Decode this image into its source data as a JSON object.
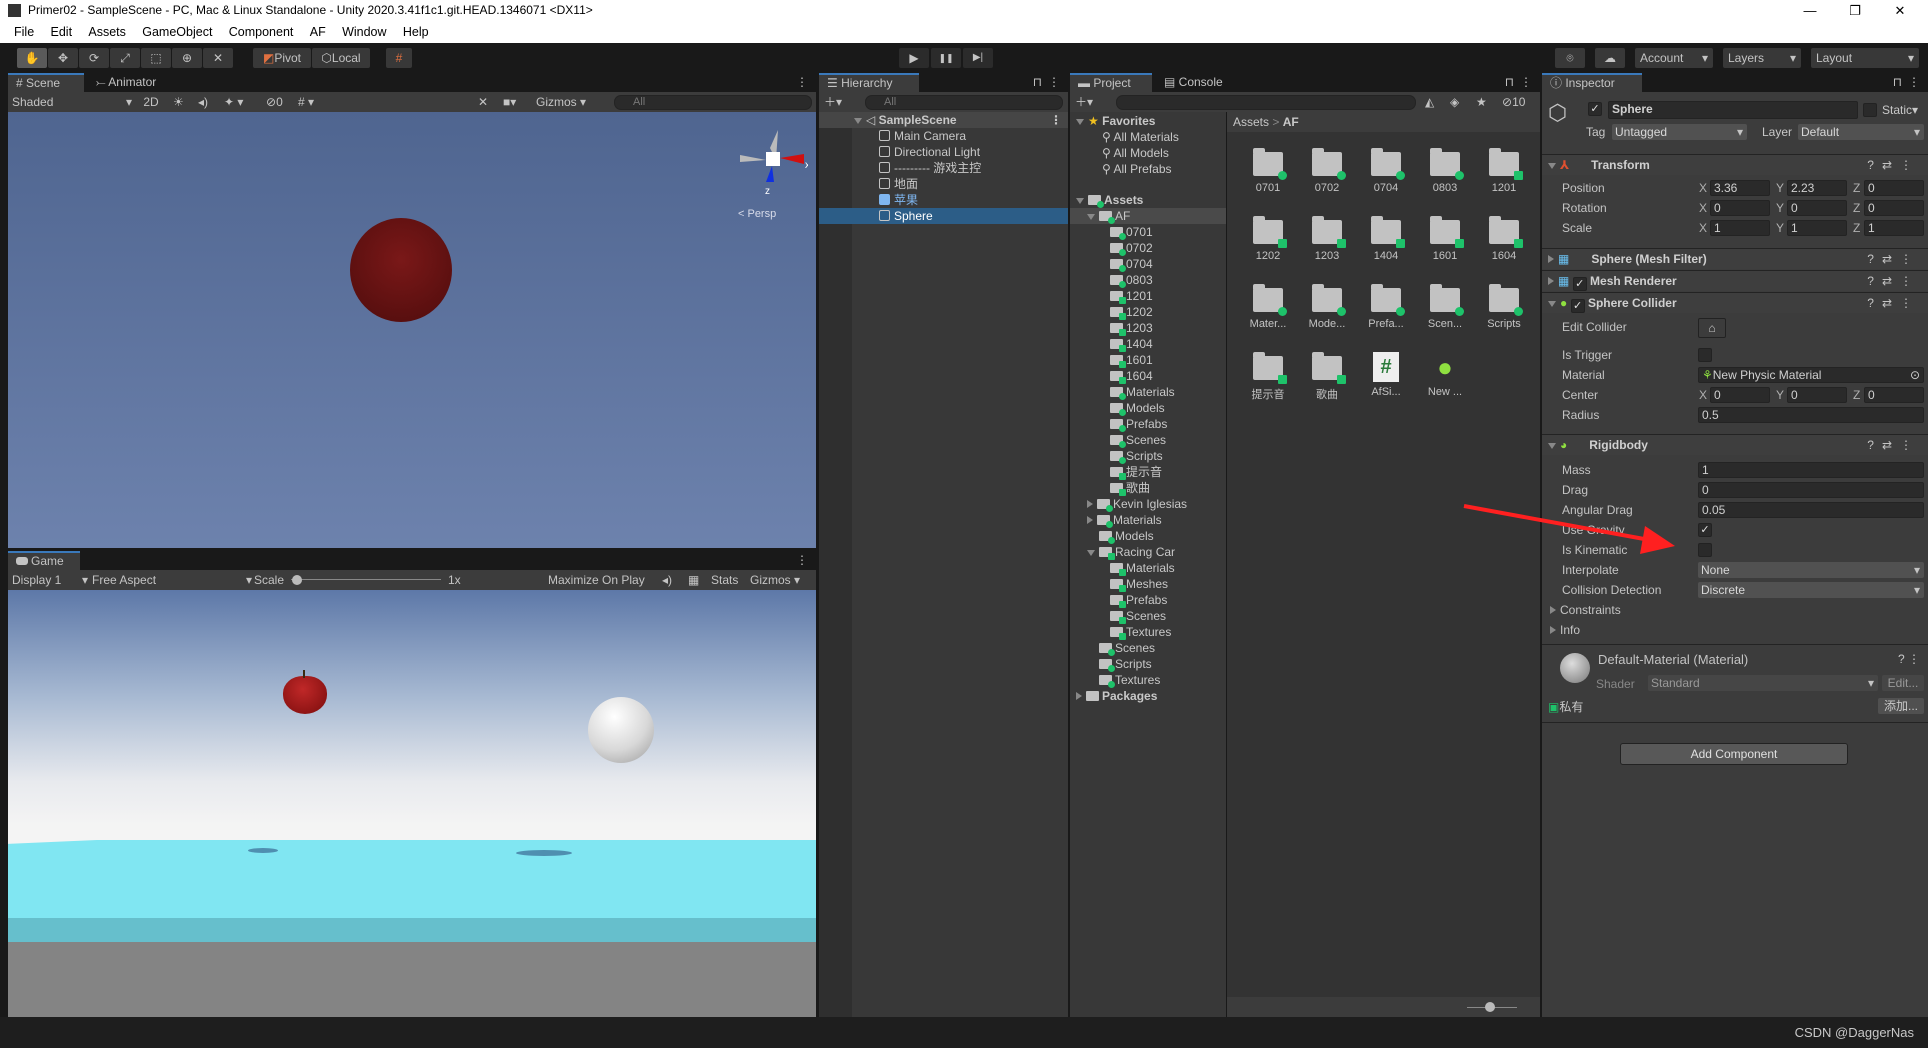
{
  "window": {
    "title": "Primer02 - SampleScene - PC, Mac & Linux Standalone - Unity 2020.3.41f1c1.git.HEAD.1346071 <DX11>",
    "min": "—",
    "max": "❐",
    "close": "✕"
  },
  "menu": [
    "File",
    "Edit",
    "Assets",
    "GameObject",
    "Component",
    "AF",
    "Window",
    "Help"
  ],
  "toolbar": {
    "pivot": "Pivot",
    "local": "Local",
    "account": "Account",
    "layers": "Layers",
    "layout": "Layout",
    "play": "▶",
    "pause": "❚❚",
    "step": "▶|"
  },
  "scene": {
    "tabs": [
      "Scene",
      "Animator"
    ],
    "shading": "Shaded",
    "mode2d": "2D",
    "hidden_count": "0",
    "gizmos": "Gizmos",
    "search_placeholder": "All",
    "gizmo_x": "x",
    "gizmo_z": "z",
    "persp": "< Persp"
  },
  "game": {
    "tab": "Game",
    "display": "Display 1",
    "aspect": "Free Aspect",
    "scale_label": "Scale",
    "scale_value": "1x",
    "maximize": "Maximize On Play",
    "stats": "Stats",
    "gizmos": "Gizmos"
  },
  "hierarchy": {
    "tab": "Hierarchy",
    "search_placeholder": "All",
    "scene": "SampleScene",
    "items": [
      {
        "label": "Main Camera"
      },
      {
        "label": "Directional Light"
      },
      {
        "label": "--------- 游戏主控"
      },
      {
        "label": "地面"
      },
      {
        "label": "苹果",
        "prefab": true
      },
      {
        "label": "Sphere",
        "selected": true
      }
    ]
  },
  "project": {
    "tabs": [
      "Project",
      "Console"
    ],
    "hidden_count": "10",
    "favorites": "Favorites",
    "favorite_items": [
      "All Materials",
      "All Models",
      "All Prefabs"
    ],
    "tree": [
      {
        "label": "Assets",
        "depth": 0,
        "arrow": "down",
        "bold": true
      },
      {
        "label": "AF",
        "depth": 1,
        "arrow": "down",
        "selected": true
      },
      {
        "label": "0701",
        "depth": 2
      },
      {
        "label": "0702",
        "depth": 2
      },
      {
        "label": "0704",
        "depth": 2
      },
      {
        "label": "0803",
        "depth": 2
      },
      {
        "label": "1201",
        "depth": 2,
        "sq": true
      },
      {
        "label": "1202",
        "depth": 2,
        "sq": true
      },
      {
        "label": "1203",
        "depth": 2,
        "sq": true
      },
      {
        "label": "1404",
        "depth": 2,
        "sq": true
      },
      {
        "label": "1601",
        "depth": 2,
        "sq": true
      },
      {
        "label": "1604",
        "depth": 2,
        "sq": true
      },
      {
        "label": "Materials",
        "depth": 2
      },
      {
        "label": "Models",
        "depth": 2
      },
      {
        "label": "Prefabs",
        "depth": 2
      },
      {
        "label": "Scenes",
        "depth": 2
      },
      {
        "label": "Scripts",
        "depth": 2
      },
      {
        "label": "提示音",
        "depth": 2,
        "sq": true
      },
      {
        "label": "歌曲",
        "depth": 2,
        "sq": true
      },
      {
        "label": "Kevin Iglesias",
        "depth": 1,
        "arrow": "right"
      },
      {
        "label": "Materials",
        "depth": 1,
        "arrow": "right"
      },
      {
        "label": "Models",
        "depth": 1
      },
      {
        "label": "Racing Car",
        "depth": 1,
        "arrow": "down",
        "sq": true
      },
      {
        "label": "Materials",
        "depth": 2,
        "sq": true
      },
      {
        "label": "Meshes",
        "depth": 2,
        "sq": true
      },
      {
        "label": "Prefabs",
        "depth": 2,
        "sq": true
      },
      {
        "label": "Scenes",
        "depth": 2,
        "sq": true
      },
      {
        "label": "Textures",
        "depth": 2,
        "sq": true
      },
      {
        "label": "Scenes",
        "depth": 1
      },
      {
        "label": "Scripts",
        "depth": 1
      },
      {
        "label": "Textures",
        "depth": 1
      },
      {
        "label": "Packages",
        "depth": 0,
        "arrow": "right",
        "bold": true,
        "plain": true
      }
    ],
    "breadcrumb": [
      "Assets",
      "AF"
    ],
    "grid": [
      {
        "label": "0701",
        "kind": "folder"
      },
      {
        "label": "0702",
        "kind": "folder"
      },
      {
        "label": "0704",
        "kind": "folder"
      },
      {
        "label": "0803",
        "kind": "folder"
      },
      {
        "label": "1201",
        "kind": "folder",
        "sq": true
      },
      {
        "label": "1202",
        "kind": "folder",
        "sq": true
      },
      {
        "label": "1203",
        "kind": "folder",
        "sq": true
      },
      {
        "label": "1404",
        "kind": "folder",
        "sq": true
      },
      {
        "label": "1601",
        "kind": "folder",
        "sq": true
      },
      {
        "label": "1604",
        "kind": "folder",
        "sq": true
      },
      {
        "label": "Mater...",
        "kind": "folder"
      },
      {
        "label": "Mode...",
        "kind": "folder"
      },
      {
        "label": "Prefa...",
        "kind": "folder"
      },
      {
        "label": "Scen...",
        "kind": "folder"
      },
      {
        "label": "Scripts",
        "kind": "folder"
      },
      {
        "label": "提示音",
        "kind": "folder",
        "sq": true
      },
      {
        "label": "歌曲",
        "kind": "folder",
        "sq": true
      },
      {
        "label": "AfSi...",
        "kind": "script"
      },
      {
        "label": "New ...",
        "kind": "physic-material"
      }
    ]
  },
  "inspector": {
    "tab": "Inspector",
    "name": "Sphere",
    "active": true,
    "static": "Static",
    "tag_label": "Tag",
    "tag": "Untagged",
    "layer_label": "Layer",
    "layer": "Default",
    "transform": {
      "title": "Transform",
      "rows": [
        {
          "label": "Position",
          "x": "3.36",
          "y": "2.23",
          "z": "0"
        },
        {
          "label": "Rotation",
          "x": "0",
          "y": "0",
          "z": "0"
        },
        {
          "label": "Scale",
          "x": "1",
          "y": "1",
          "z": "1"
        }
      ]
    },
    "mesh_filter": "Sphere (Mesh Filter)",
    "mesh_renderer": "Mesh Renderer",
    "collider": {
      "title": "Sphere Collider",
      "edit_label": "Edit Collider",
      "trigger_label": "Is Trigger",
      "is_trigger": false,
      "material_label": "Material",
      "material": "New Physic Material",
      "center_label": "Center",
      "center": {
        "x": "0",
        "y": "0",
        "z": "0"
      },
      "radius_label": "Radius",
      "radius": "0.5"
    },
    "rigidbody": {
      "title": "Rigidbody",
      "mass_label": "Mass",
      "mass": "1",
      "drag_label": "Drag",
      "drag": "0",
      "angular_label": "Angular Drag",
      "angular": "0.05",
      "gravity_label": "Use Gravity",
      "use_gravity": true,
      "kinematic_label": "Is Kinematic",
      "is_kinematic": false,
      "interp_label": "Interpolate",
      "interpolate": "None",
      "collision_label": "Collision Detection",
      "collision": "Discrete",
      "constraints": "Constraints",
      "info": "Info"
    },
    "material": {
      "title": "Default-Material (Material)",
      "shader_label": "Shader",
      "shader": "Standard",
      "edit": "Edit...",
      "private": "私有",
      "add": "添加..."
    },
    "add_component": "Add Component"
  },
  "watermark": "CSDN @DaggerNas",
  "colors": {
    "accent": "#3a79bb",
    "selection": "#2c5d87",
    "annotation_arrow": "#ff2020",
    "scene_ball": "#6b1414",
    "plane": "#7de4f0"
  }
}
